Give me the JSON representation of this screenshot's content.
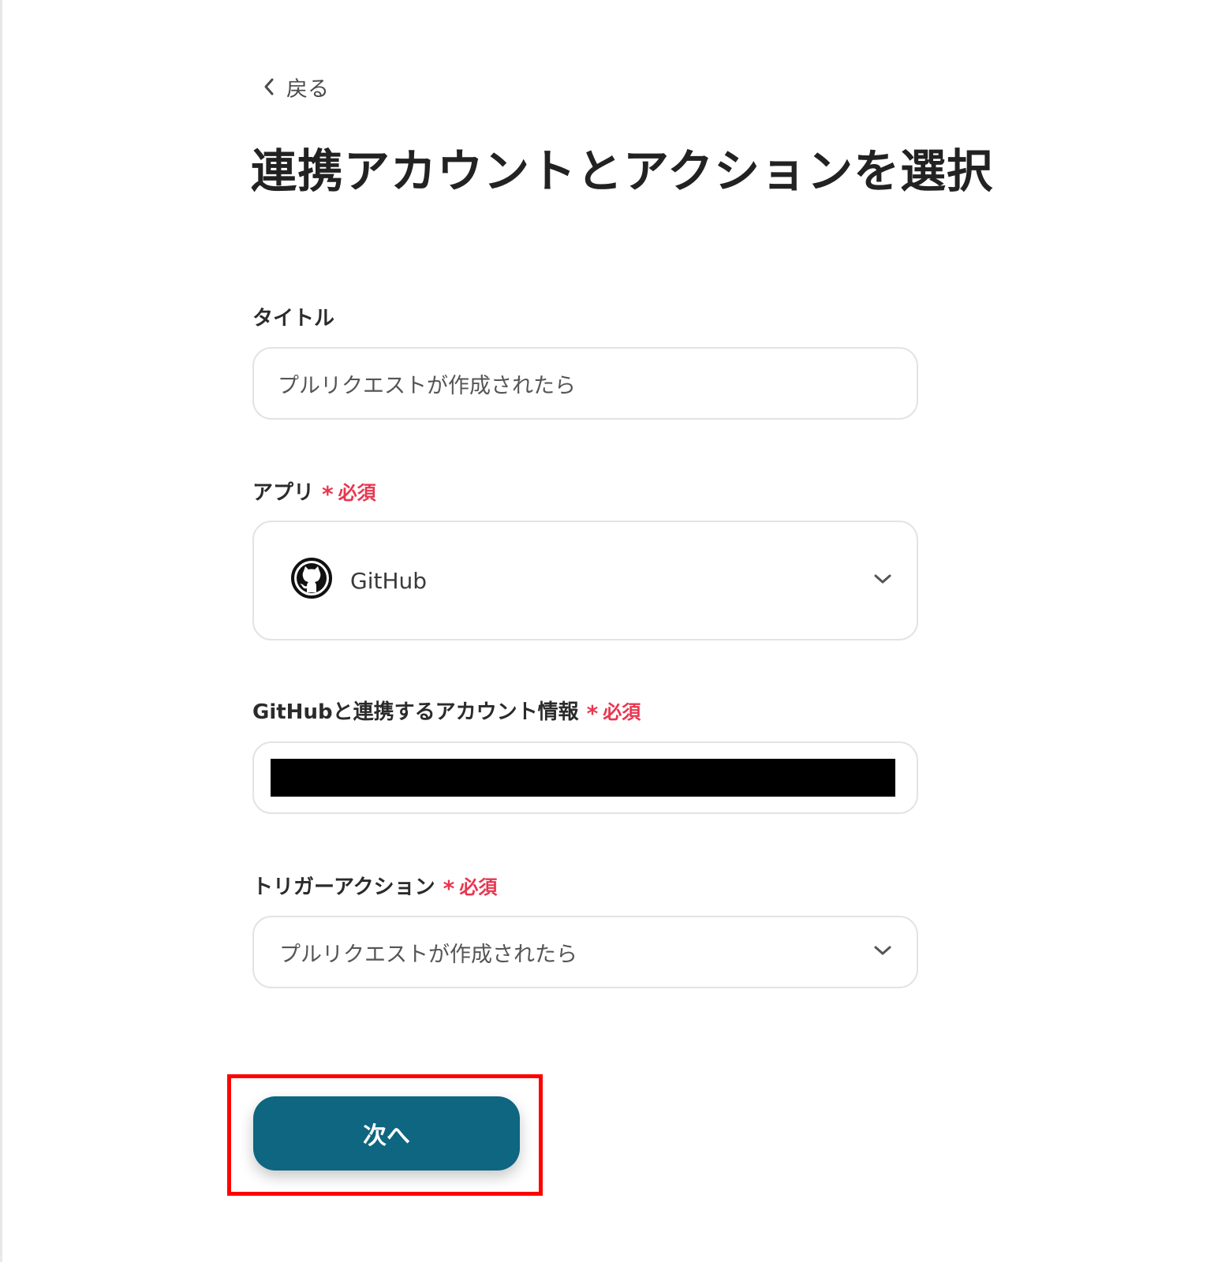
{
  "nav": {
    "back_label": "戻る"
  },
  "page": {
    "title": "連携アカウントとアクションを選択"
  },
  "required_label": "必須",
  "required_star": "*",
  "form": {
    "title_field": {
      "label": "タイトル",
      "value": "プルリクエストが作成されたら"
    },
    "app_field": {
      "label": "アプリ",
      "value": "GitHub",
      "icon": "github-icon"
    },
    "account_field": {
      "label": "GitHubと連携するアカウント情報",
      "value_redacted": true
    },
    "trigger_field": {
      "label": "トリガーアクション",
      "value": "プルリクエストが作成されたら"
    }
  },
  "buttons": {
    "next_label": "次へ"
  },
  "colors": {
    "primary": "#0e6680",
    "required": "#e8364f",
    "highlight": "#ff0000",
    "border": "#e3e3e3"
  }
}
